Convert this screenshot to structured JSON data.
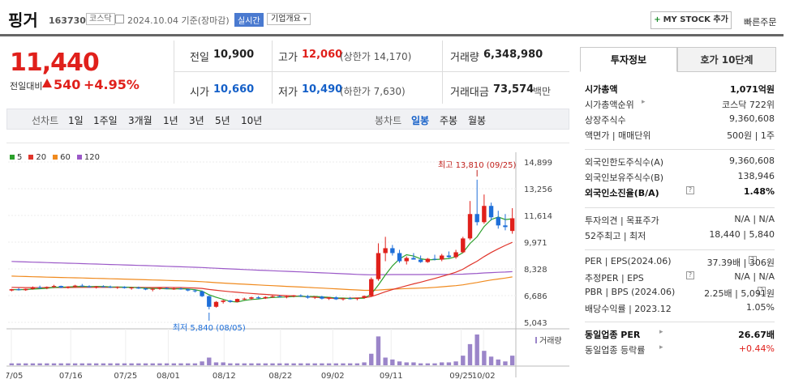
{
  "header": {
    "name": "핑거",
    "code": "163730",
    "market": "코스닥",
    "date": "2024.10.04 기준(장마감)",
    "realtime": "실시간",
    "corp_info": "기업개요",
    "mystock": "MY STOCK 추가",
    "quick_order": "빠른주문"
  },
  "price": {
    "current": "11,440",
    "change_label": "전일대비",
    "change_amount": "540",
    "change_pct": "+4.95%"
  },
  "quote": {
    "prev_label": "전일",
    "prev": "10,900",
    "high_label": "고가",
    "high": "12,060",
    "upper_limit": "(상한가 14,170)",
    "volume_label": "거래량",
    "volume": "6,348,980",
    "open_label": "시가",
    "open": "10,660",
    "low_label": "저가",
    "low": "10,490",
    "lower_limit": "(하한가 7,630)",
    "amount_label": "거래대금",
    "amount": "73,574",
    "amount_unit": "백만"
  },
  "periods": {
    "line_label": "선차트",
    "line": [
      "1일",
      "1주일",
      "3개월",
      "1년",
      "3년",
      "5년",
      "10년"
    ],
    "candle_label": "봉차트",
    "candle": [
      "일봉",
      "주봉",
      "월봉"
    ],
    "selected": "일봉"
  },
  "right_panel": {
    "tab_invest": "투자정보",
    "tab_order": "호가 10단계",
    "rows1": [
      {
        "l": "시가총액",
        "r": "1,071억원",
        "bold": true
      },
      {
        "l": "시가총액순위",
        "r": "코스닥 722위"
      },
      {
        "l": "상장주식수",
        "r": "9,360,608"
      },
      {
        "l": "액면가 | 매매단위",
        "r": "500원 | 1주"
      }
    ],
    "rows2": [
      {
        "l": "외국인한도주식수(A)",
        "r": "9,360,608"
      },
      {
        "l": "외국인보유주식수(B)",
        "r": "138,946"
      },
      {
        "l": "외국인소진율(B/A)",
        "r": "1.48%",
        "bold": true
      }
    ],
    "rows3": [
      {
        "l": "투자의견 | 목표주가",
        "r": "N/A | N/A"
      },
      {
        "l": "52주최고 | 최저",
        "r": "18,440 | 5,840"
      }
    ],
    "rows4": [
      {
        "l": "PER | EPS(2024.06)",
        "r": "37.39배 | 306원"
      },
      {
        "l": "추정PER | EPS",
        "r": "N/A | N/A"
      },
      {
        "l": "PBR | BPS (2024.06)",
        "r": "2.25배 | 5,091원"
      },
      {
        "l": "배당수익률 | 2023.12",
        "r": "1.05%"
      }
    ],
    "rows5": [
      {
        "l": "동일업종 PER",
        "r": "26.67배",
        "bold": true
      },
      {
        "l": "동일업종 등락률",
        "r": "+0.44%",
        "up": true
      }
    ]
  },
  "chart_data": {
    "type": "candlestick",
    "legend": [
      {
        "name": "5",
        "color": "#2ca02c"
      },
      {
        "name": "20",
        "color": "#e0352b"
      },
      {
        "name": "60",
        "color": "#f08a1e"
      },
      {
        "name": "120",
        "color": "#9b59c8"
      }
    ],
    "y_ticks": [
      14899,
      13256,
      11614,
      9971,
      8328,
      6686,
      5043
    ],
    "ylim": [
      5043,
      14899
    ],
    "x_ticks": [
      "07/05",
      "07/16",
      "07/25",
      "08/01",
      "08/12",
      "08/22",
      "09/02",
      "09/11",
      "09/25",
      "10/02"
    ],
    "annotations": {
      "high": "최고 13,810 (09/25)",
      "low": "최저 5,840 (08/05)"
    },
    "volume_label": "거래량",
    "candles": [
      [
        7000,
        7100,
        6950,
        7080
      ],
      [
        7080,
        7150,
        7000,
        7020
      ],
      [
        7020,
        7120,
        6980,
        7100
      ],
      [
        7100,
        7250,
        7050,
        7200
      ],
      [
        7200,
        7300,
        7100,
        7150
      ],
      [
        7150,
        7250,
        7080,
        7220
      ],
      [
        7220,
        7350,
        7150,
        7280
      ],
      [
        7280,
        7300,
        7150,
        7180
      ],
      [
        7180,
        7260,
        7120,
        7240
      ],
      [
        7240,
        7350,
        7200,
        7300
      ],
      [
        7300,
        7400,
        7220,
        7260
      ],
      [
        7260,
        7320,
        7180,
        7200
      ],
      [
        7200,
        7280,
        7120,
        7250
      ],
      [
        7250,
        7320,
        7200,
        7230
      ],
      [
        7230,
        7300,
        7150,
        7180
      ],
      [
        7180,
        7250,
        7100,
        7220
      ],
      [
        7220,
        7260,
        7120,
        7150
      ],
      [
        7150,
        7220,
        7050,
        7180
      ],
      [
        7180,
        7240,
        7100,
        7120
      ],
      [
        7120,
        7180,
        7020,
        7060
      ],
      [
        7060,
        7150,
        6950,
        7100
      ],
      [
        7100,
        7180,
        7050,
        7150
      ],
      [
        7150,
        7200,
        7080,
        7100
      ],
      [
        7100,
        7160,
        7040,
        7120
      ],
      [
        7120,
        7180,
        7050,
        7080
      ],
      [
        7080,
        7120,
        6950,
        7000
      ],
      [
        7000,
        7080,
        6880,
        6950
      ],
      [
        6950,
        7000,
        6600,
        6650
      ],
      [
        6650,
        6700,
        5840,
        6000
      ],
      [
        6000,
        6350,
        5950,
        6300
      ],
      [
        6300,
        6420,
        6200,
        6380
      ],
      [
        6380,
        6420,
        6250,
        6300
      ],
      [
        6300,
        6500,
        6280,
        6480
      ],
      [
        6480,
        6560,
        6400,
        6500
      ],
      [
        6500,
        6620,
        6420,
        6580
      ],
      [
        6580,
        6650,
        6480,
        6520
      ],
      [
        6520,
        6640,
        6480,
        6600
      ],
      [
        6600,
        6700,
        6550,
        6650
      ],
      [
        6650,
        6720,
        6560,
        6600
      ],
      [
        6600,
        6680,
        6520,
        6640
      ],
      [
        6640,
        6720,
        6580,
        6700
      ],
      [
        6700,
        6760,
        6600,
        6650
      ],
      [
        6650,
        6720,
        6500,
        6560
      ],
      [
        6560,
        6650,
        6480,
        6620
      ],
      [
        6620,
        6680,
        6450,
        6500
      ],
      [
        6500,
        6600,
        6420,
        6580
      ],
      [
        6580,
        6640,
        6420,
        6460
      ],
      [
        6460,
        6560,
        6380,
        6520
      ],
      [
        6520,
        6600,
        6450,
        6480
      ],
      [
        6480,
        6560,
        6400,
        6540
      ],
      [
        6540,
        6700,
        6500,
        6660
      ],
      [
        6660,
        7800,
        6640,
        7700
      ],
      [
        7700,
        9900,
        7600,
        9300
      ],
      [
        9300,
        10300,
        8800,
        9600
      ],
      [
        9600,
        9800,
        9150,
        9300
      ],
      [
        9300,
        9500,
        8700,
        8800
      ],
      [
        8800,
        9100,
        8600,
        9000
      ],
      [
        9000,
        9300,
        8900,
        8900
      ],
      [
        8900,
        9150,
        8700,
        8750
      ],
      [
        8750,
        9000,
        8700,
        8950
      ],
      [
        8950,
        9200,
        8850,
        8900
      ],
      [
        8900,
        9250,
        8800,
        9150
      ],
      [
        9150,
        9400,
        9000,
        9050
      ],
      [
        9050,
        9500,
        8950,
        9350
      ],
      [
        9350,
        10300,
        9300,
        10200
      ],
      [
        10200,
        12500,
        10100,
        11700
      ],
      [
        11700,
        13810,
        11000,
        11200
      ],
      [
        11200,
        12900,
        11100,
        12200
      ],
      [
        12200,
        12400,
        11300,
        11500
      ],
      [
        11500,
        11900,
        10800,
        11000
      ],
      [
        11000,
        11700,
        10700,
        10900
      ],
      [
        10660,
        12060,
        10490,
        11440
      ]
    ],
    "volumes": [
      2,
      2,
      2,
      2,
      2,
      2,
      2,
      2,
      2,
      2,
      2,
      2,
      2,
      2,
      2,
      2,
      2,
      2,
      2,
      2,
      2,
      2,
      2,
      2,
      2,
      2,
      2,
      4,
      8,
      3,
      3,
      2,
      2,
      2,
      2,
      2,
      2,
      2,
      2,
      2,
      2,
      2,
      2,
      2,
      2,
      2,
      2,
      2,
      2,
      2,
      3,
      12,
      30,
      8,
      6,
      4,
      3,
      3,
      2,
      2,
      2,
      3,
      3,
      4,
      10,
      22,
      32,
      15,
      9,
      6,
      4,
      10
    ]
  }
}
